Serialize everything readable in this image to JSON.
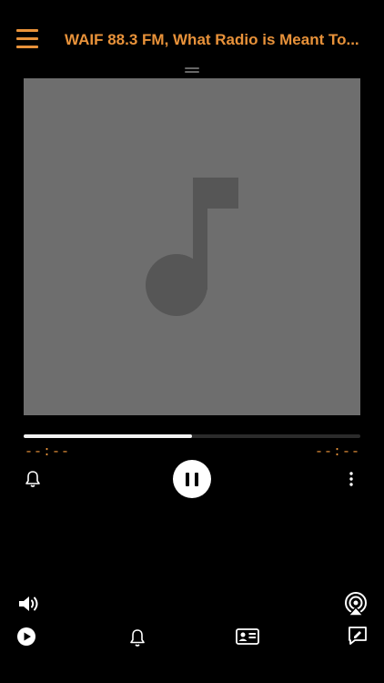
{
  "header": {
    "title": "WAIF 88.3 FM,  What Radio is Meant To..."
  },
  "player": {
    "progress": 0.5,
    "time_elapsed": "--:--",
    "time_remaining": "--:--"
  },
  "colors": {
    "accent": "#e8923a",
    "background": "#000000",
    "artwork": "#6e6e6e",
    "artwork_glyph": "#565656"
  },
  "icons": {
    "menu": "hamburger-icon",
    "artwork": "music-note-icon",
    "alarm": "bell-icon",
    "play_pause": "pause-icon",
    "more": "more-vertical-icon",
    "volume": "speaker-icon",
    "airplay": "airplay-icon",
    "play": "play-icon",
    "alarm_bottom": "bell-icon",
    "contact": "contact-card-icon",
    "note": "note-edit-icon"
  }
}
